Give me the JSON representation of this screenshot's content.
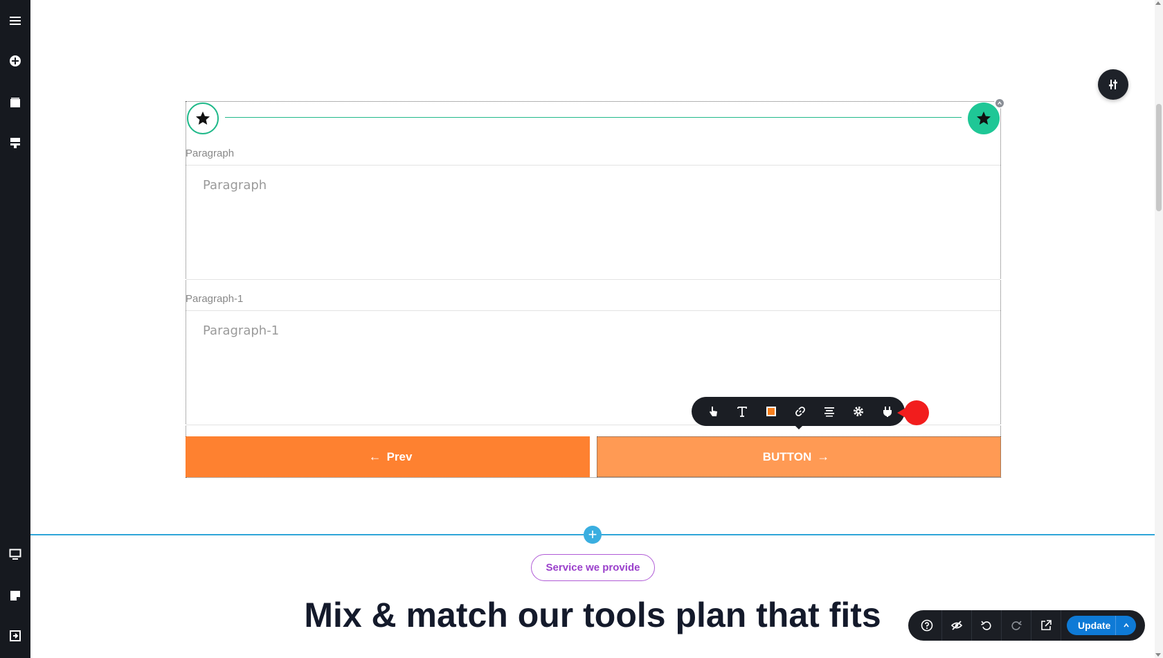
{
  "sidebar": {
    "items": [
      {
        "name": "menu-icon"
      },
      {
        "name": "add-element-icon"
      },
      {
        "name": "pages-icon"
      },
      {
        "name": "layers-icon"
      },
      {
        "name": "desktop-view-icon"
      },
      {
        "name": "notes-icon"
      },
      {
        "name": "exit-icon"
      }
    ]
  },
  "form": {
    "fields": [
      {
        "label": "Paragraph",
        "placeholder": "Paragraph"
      },
      {
        "label": "Paragraph-1",
        "placeholder": "Paragraph-1"
      }
    ],
    "prev_label": "Prev",
    "next_label": "BUTTON",
    "step_color": "#21b98a",
    "prev_color": "#fe8130",
    "next_color": "#ff9a54"
  },
  "element_toolbar": {
    "items": [
      "pointer-icon",
      "text-icon",
      "color-fill-icon",
      "link-icon",
      "align-icon",
      "settings-icon",
      "plugin-icon"
    ],
    "accent": "#f7801f"
  },
  "section": {
    "pill_label": "Service we provide",
    "headline": "Mix & match our tools plan that fits"
  },
  "bottom_bar": {
    "items": [
      "help-icon",
      "hide-icon",
      "undo-icon",
      "redo-icon",
      "external-link-icon"
    ],
    "update_label": "Update",
    "accent": "#0e7ad6"
  }
}
